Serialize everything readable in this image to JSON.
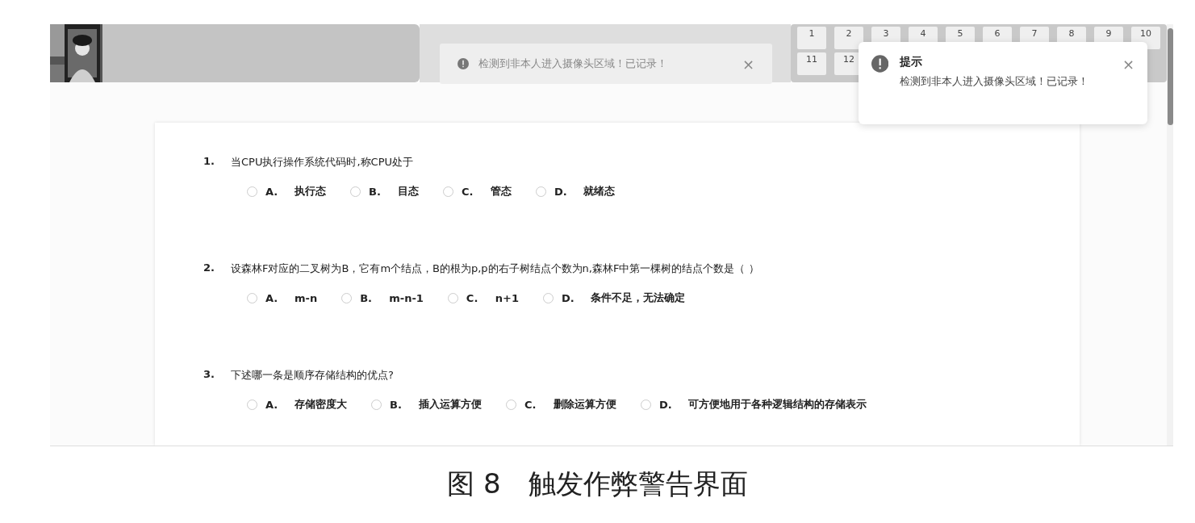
{
  "toast": {
    "message": "检测到非本人进入摄像头区域！已记录！",
    "close": "×"
  },
  "question_nav": {
    "rows": [
      [
        "1",
        "2",
        "3",
        "4",
        "5",
        "6",
        "7",
        "8",
        "9",
        "10"
      ],
      [
        "11",
        "12"
      ]
    ]
  },
  "notification": {
    "title": "提示",
    "message": "检测到非本人进入摄像头区域！已记录！",
    "close": "×"
  },
  "questions": [
    {
      "number": "1.",
      "text": "当CPU执行操作系统代码时,称CPU处于",
      "options": [
        {
          "letter": "A.",
          "text": "执行态",
          "selected": false
        },
        {
          "letter": "B.",
          "text": "目态",
          "selected": false
        },
        {
          "letter": "C.",
          "text": "管态",
          "selected": false
        },
        {
          "letter": "D.",
          "text": "就绪态",
          "selected": false
        }
      ]
    },
    {
      "number": "2.",
      "text": "设森林F对应的二叉树为B，它有m个结点，B的根为p,p的右子树结点个数为n,森林F中第一棵树的结点个数是（ ）",
      "options": [
        {
          "letter": "A.",
          "text": "m-n",
          "selected": false
        },
        {
          "letter": "B.",
          "text": "m-n-1",
          "selected": false
        },
        {
          "letter": "C.",
          "text": "n+1",
          "selected": false
        },
        {
          "letter": "D.",
          "text": "条件不足，无法确定",
          "selected": false
        }
      ]
    },
    {
      "number": "3.",
      "text": "下述哪一条是顺序存储结构的优点?",
      "options": [
        {
          "letter": "A.",
          "text": "存储密度大",
          "selected": false
        },
        {
          "letter": "B.",
          "text": "插入运算方便",
          "selected": false
        },
        {
          "letter": "C.",
          "text": "删除运算方便",
          "selected": false
        },
        {
          "letter": "D.",
          "text": "可方便地用于各种逻辑结构的存储表示",
          "selected": false
        }
      ]
    }
  ],
  "caption": "图 8　触发作弊警告界面"
}
